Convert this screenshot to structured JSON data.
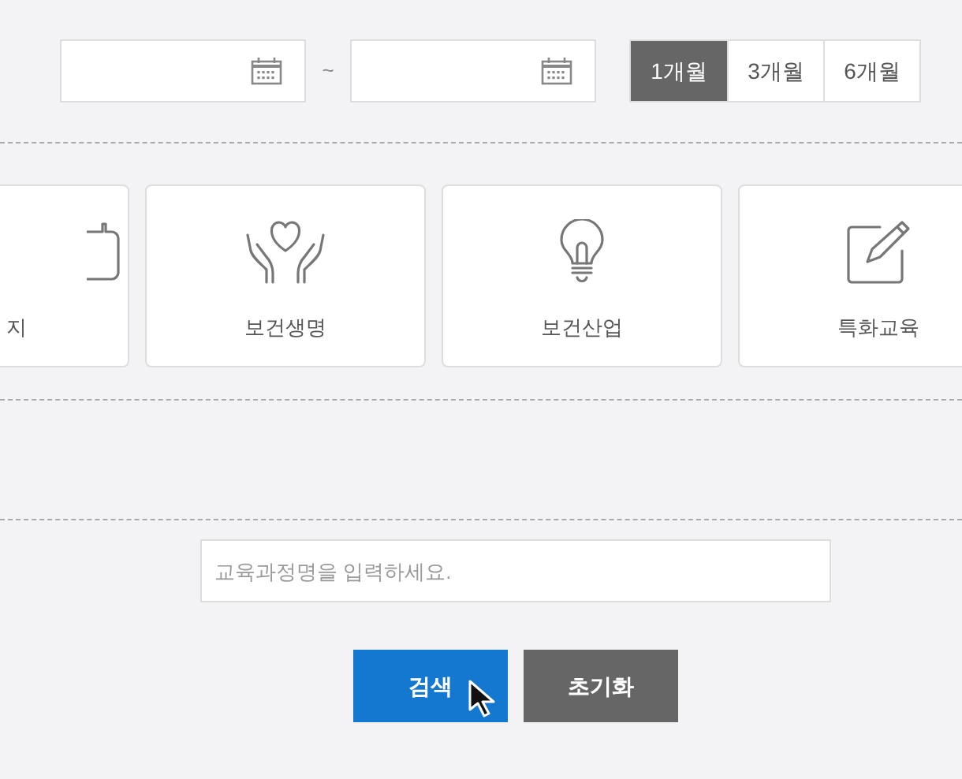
{
  "date_range": {
    "separator": "~"
  },
  "period_buttons": [
    {
      "label": "1개월",
      "selected": true
    },
    {
      "label": "3개월",
      "selected": false
    },
    {
      "label": "6개월",
      "selected": false
    }
  ],
  "categories": [
    {
      "label": "지",
      "kind": "briefcase"
    },
    {
      "label": "보건생명",
      "kind": "hands"
    },
    {
      "label": "보건산업",
      "kind": "bulb"
    },
    {
      "label": "특화교육",
      "kind": "edit"
    }
  ],
  "search": {
    "placeholder": "교육과정명을 입력하세요."
  },
  "buttons": [
    {
      "label": "검색",
      "kind": "primary"
    },
    {
      "label": "초기화",
      "kind": "secondary"
    }
  ]
}
